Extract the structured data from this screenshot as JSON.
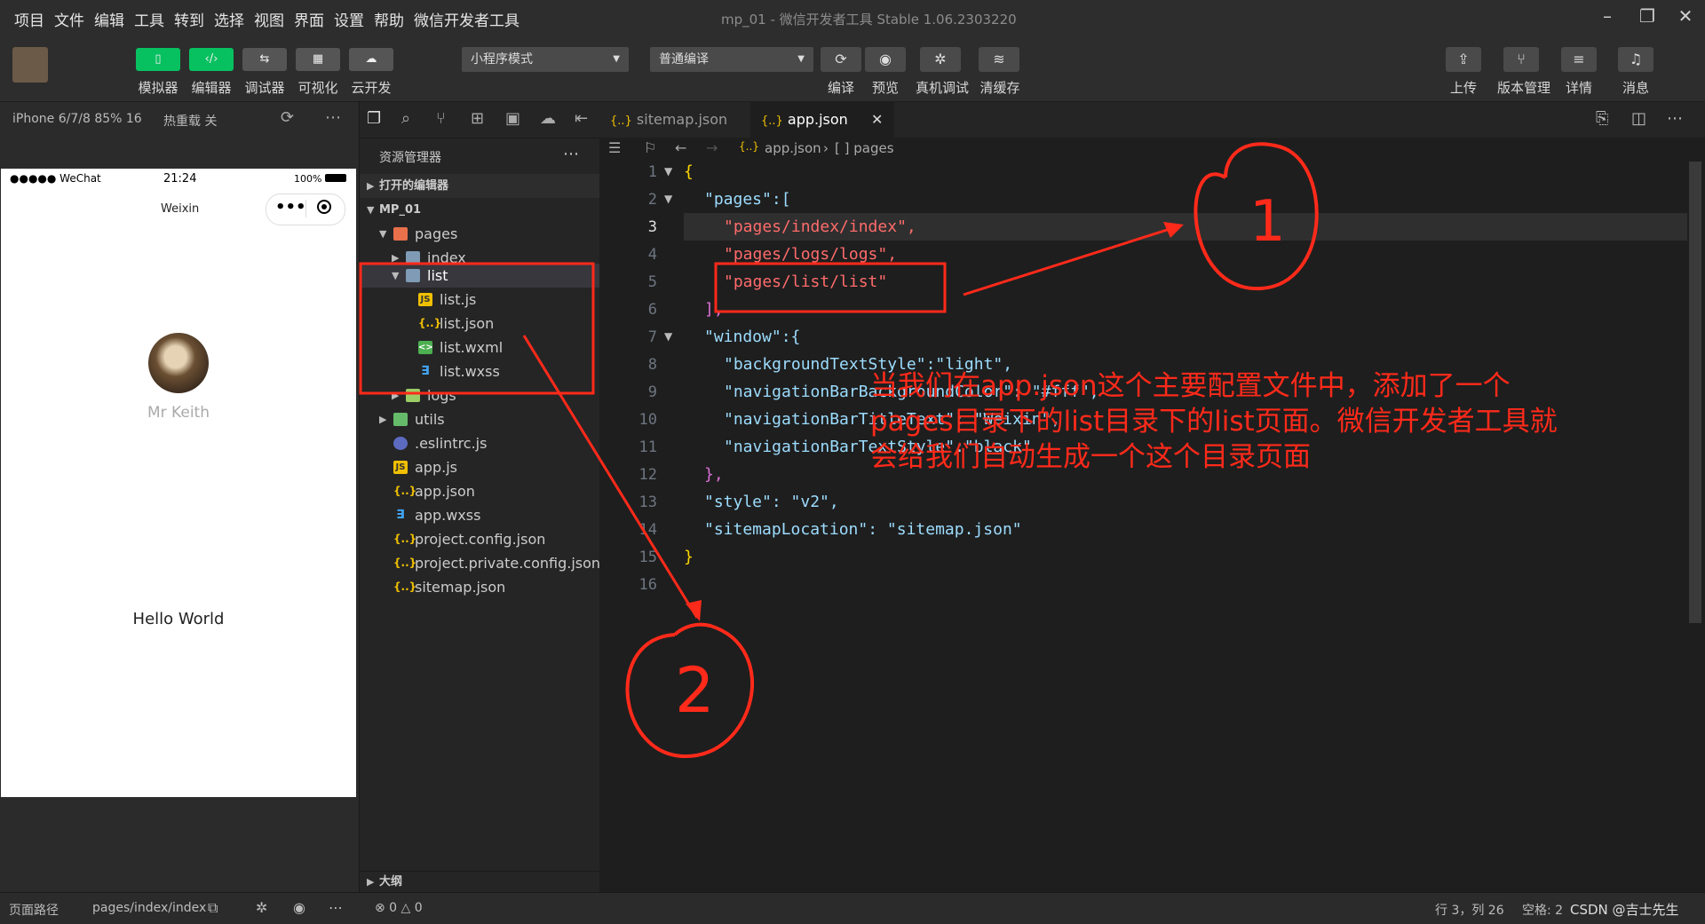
{
  "menu": [
    "项目",
    "文件",
    "编辑",
    "工具",
    "转到",
    "选择",
    "视图",
    "界面",
    "设置",
    "帮助",
    "微信开发者工具"
  ],
  "window_title": "mp_01 - 微信开发者工具 Stable 1.06.2303220",
  "toolbar": {
    "left_buttons": [
      "模拟器",
      "编辑器",
      "调试器",
      "可视化",
      "云开发"
    ],
    "mode_select": "小程序模式",
    "compile_select": "普通编译",
    "mid_buttons": [
      "编译",
      "预览",
      "真机调试",
      "清缓存"
    ],
    "right_buttons": [
      "上传",
      "版本管理",
      "详情",
      "消息"
    ]
  },
  "simbar": {
    "device": "iPhone 6/7/8 85% 16",
    "hot_reload": "热重载 关"
  },
  "phone": {
    "status_signal": "●●●●● WeChat",
    "status_time": "21:24",
    "status_battery": "100%",
    "nav_title": "Weixin",
    "username": "Mr Keith",
    "motto": "Hello World"
  },
  "explorer": {
    "title": "资源管理器",
    "open_editors": "打开的编辑器",
    "root": "MP_01",
    "rows": [
      {
        "label": "pages",
        "type": "folder"
      },
      {
        "label": "index",
        "type": "folder"
      },
      {
        "label": "list",
        "type": "folder"
      },
      {
        "label": "list.js",
        "type": "js"
      },
      {
        "label": "list.json",
        "type": "json"
      },
      {
        "label": "list.wxml",
        "type": "wxml"
      },
      {
        "label": "list.wxss",
        "type": "wxss"
      },
      {
        "label": "logs",
        "type": "folder"
      },
      {
        "label": "utils",
        "type": "folder"
      },
      {
        "label": ".eslintrc.js",
        "type": "eslint"
      },
      {
        "label": "app.js",
        "type": "js"
      },
      {
        "label": "app.json",
        "type": "json"
      },
      {
        "label": "app.wxss",
        "type": "wxss"
      },
      {
        "label": "project.config.json",
        "type": "json"
      },
      {
        "label": "project.private.config.json",
        "type": "json"
      },
      {
        "label": "sitemap.json",
        "type": "json"
      }
    ],
    "outline": "大纲"
  },
  "tabs": [
    {
      "label": "sitemap.json",
      "active": false
    },
    {
      "label": "app.json",
      "active": true
    }
  ],
  "breadcrumb": {
    "file": "app.json",
    "node": "[ ] pages"
  },
  "code_lines": [
    "{",
    "\"pages\":[",
    "\"pages/index/index\",",
    "\"pages/logs/logs\",",
    "\"pages/list/list\"",
    "],",
    "\"window\":{",
    "\"backgroundTextStyle\":\"light\",",
    "\"navigationBarBackgroundColor\": \"#fff\",",
    "\"navigationBarTitleText\": \"Weixin\",",
    "\"navigationBarTextStyle\":\"black\"",
    "},",
    "\"style\": \"v2\",",
    "\"sitemapLocation\": \"sitemap.json\"",
    "}",
    ""
  ],
  "annotation": {
    "circle1": "1",
    "circle2": "2",
    "text": "当我们在app.json这个主要配置文件中，添加了一个pages目录下的list目录下的list页面。微信开发者工具就会给我们自动生成一个这个目录页面"
  },
  "statusbar": {
    "page_path_label": "页面路径",
    "page_path": "pages/index/index",
    "problems": "⊗ 0 △ 0",
    "cursor": "行 3，列 26",
    "indent": "空格: 2",
    "watermark": "CSDN @吉士先生"
  },
  "colors": {
    "accent_green": "#07c160",
    "annotation_red": "#ff2a1a"
  }
}
